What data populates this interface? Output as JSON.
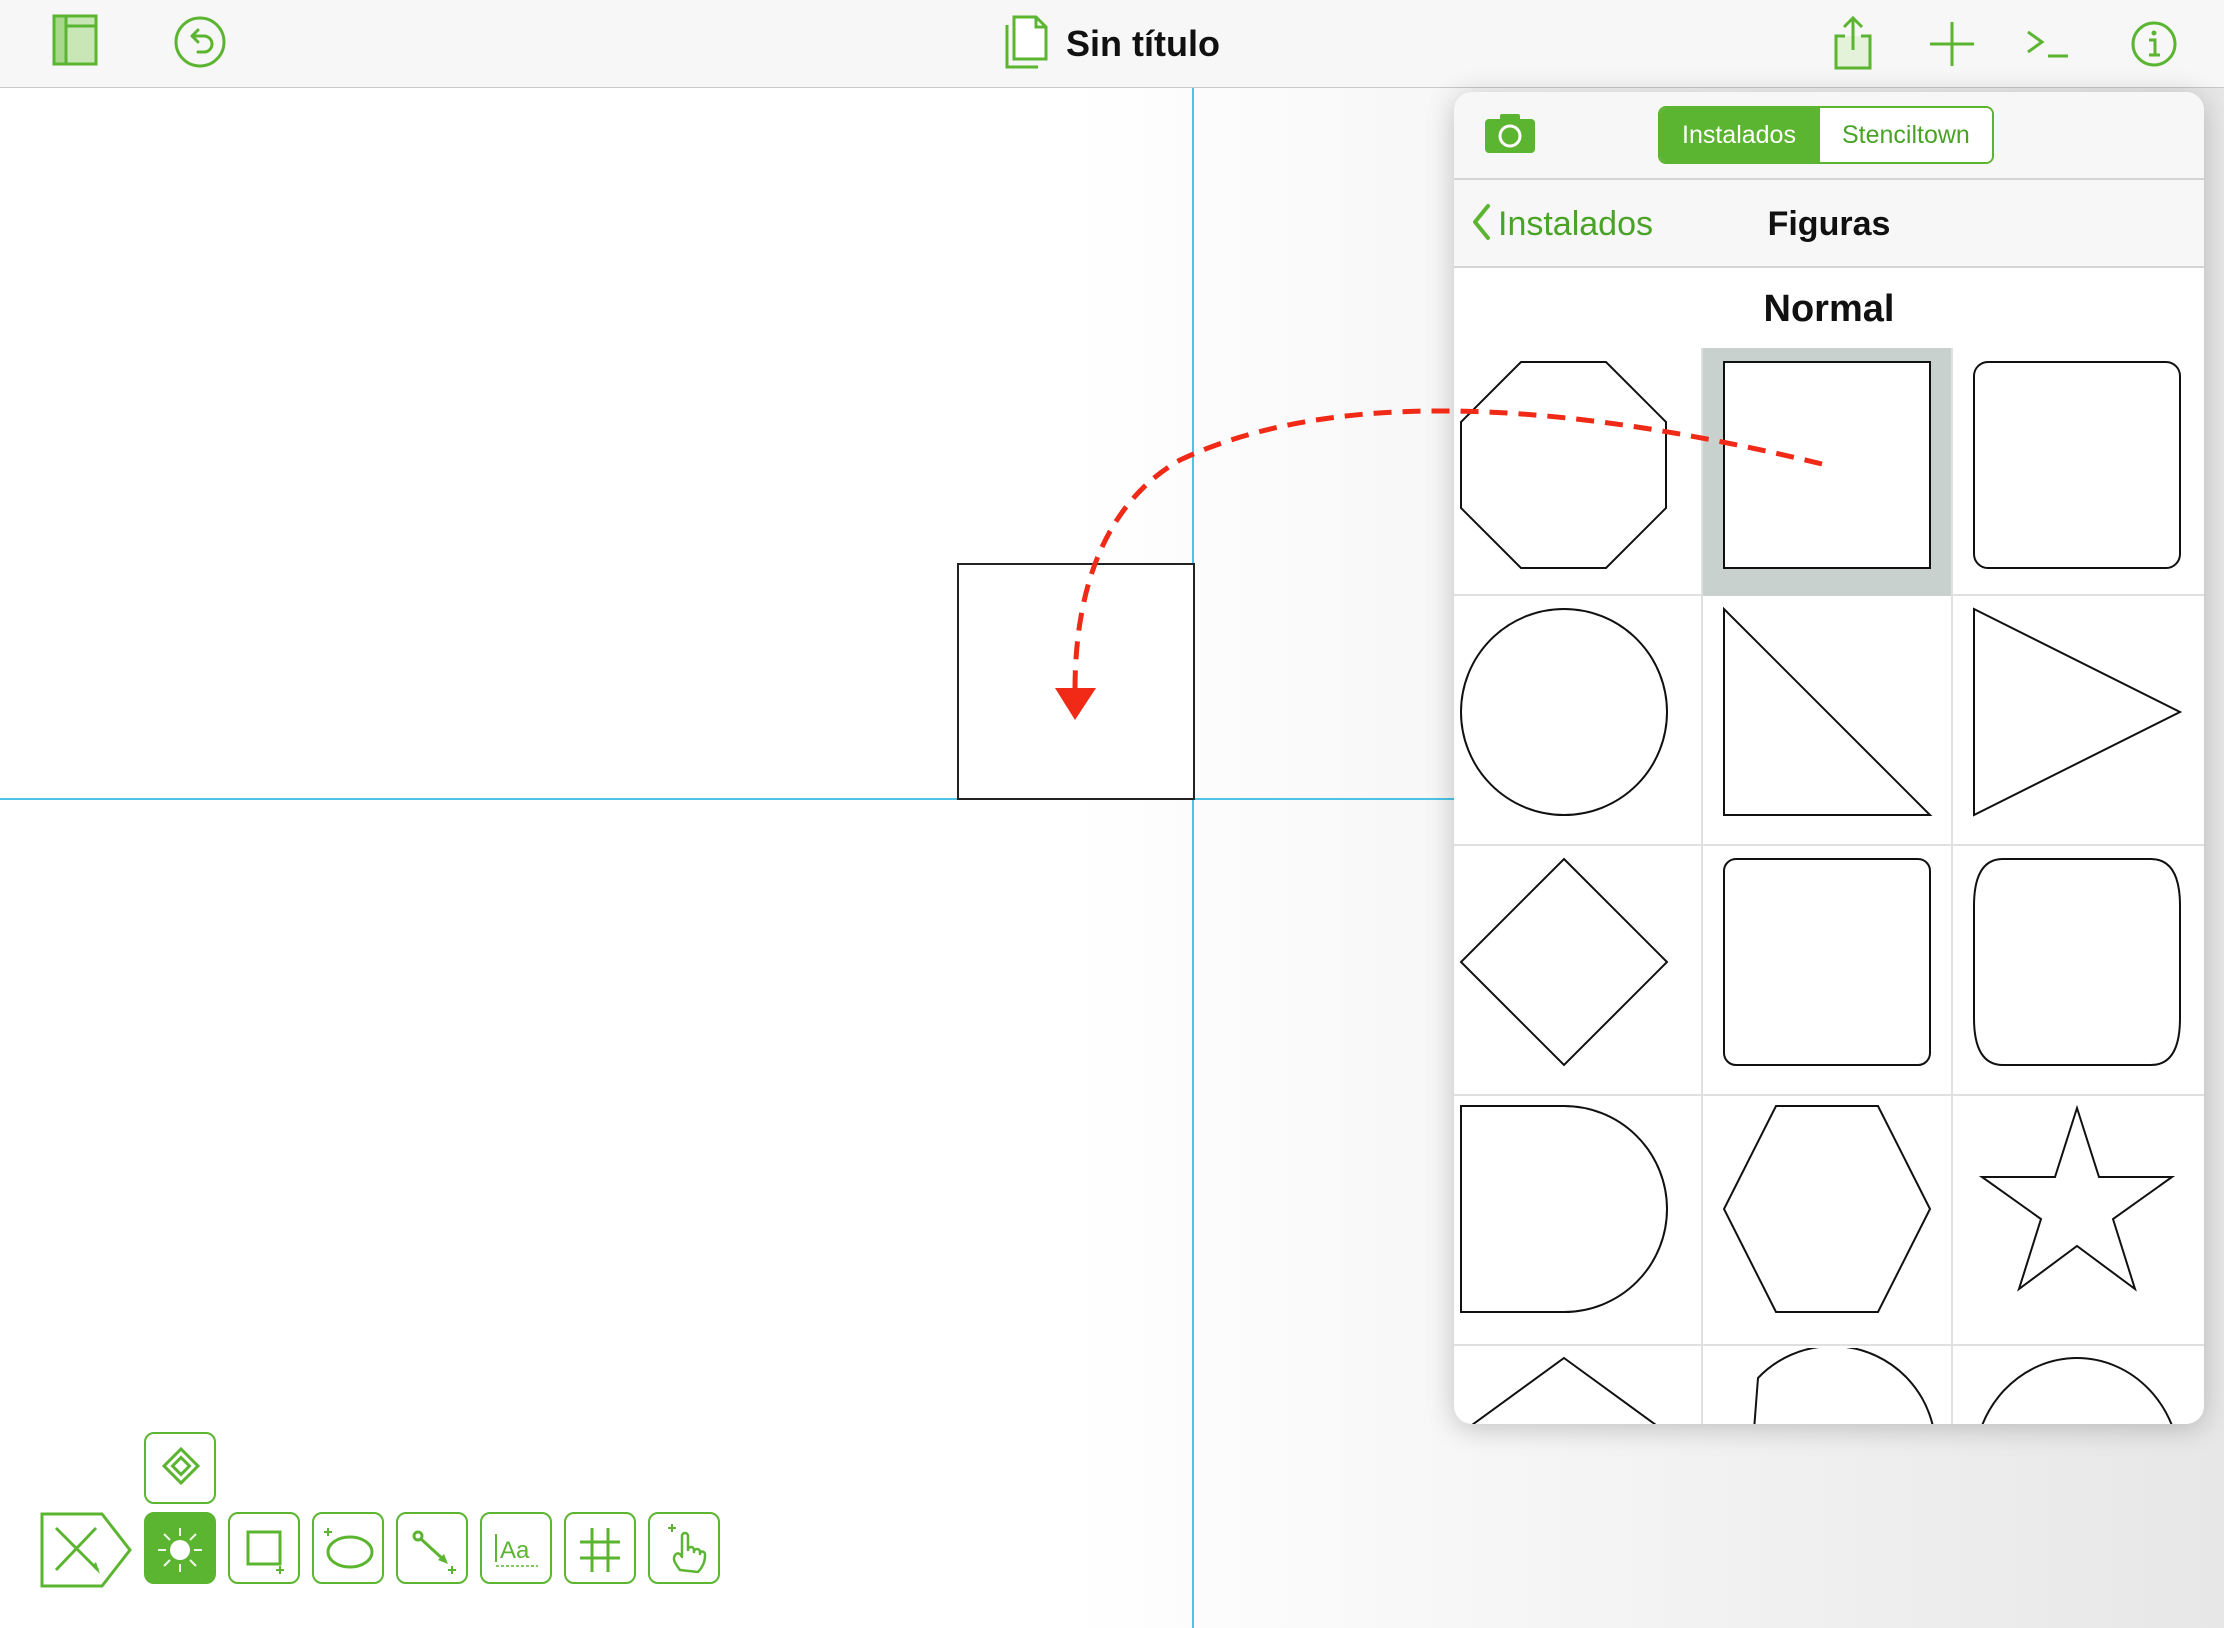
{
  "document": {
    "title": "Sin título"
  },
  "colors": {
    "accent": "#5cb531",
    "guide": "#4fc3e6",
    "arrow": "#f02a17",
    "selected_cell": "#c9d1cf"
  },
  "toolbar": {
    "left_icons": [
      "sidebar-icon",
      "undo-icon"
    ],
    "right_icons": [
      "share-icon",
      "add-icon",
      "console-icon",
      "info-icon"
    ]
  },
  "popover": {
    "camera_icon": "camera-icon",
    "segments": [
      {
        "label": "Instalados",
        "selected": true
      },
      {
        "label": "Stenciltown",
        "selected": false
      }
    ],
    "back_label": "Instalados",
    "title": "Figuras",
    "section": "Normal",
    "shapes": [
      "octagon",
      "square",
      "rounded-square",
      "circle",
      "right-triangle",
      "triangle-right",
      "diamond",
      "rounded-rectangle",
      "bulged-rectangle",
      "d-shape",
      "hexagon",
      "star",
      "pentagon",
      "circle-segment",
      "half-ellipse"
    ],
    "selected_shape": "square"
  },
  "bottom_tools": [
    "style-tool",
    "selection-tool",
    "shape-tool",
    "lasso-tool",
    "line-tool",
    "text-tool",
    "diagram-tool",
    "point-tool"
  ],
  "hint": "Drag shape from stencil onto canvas"
}
